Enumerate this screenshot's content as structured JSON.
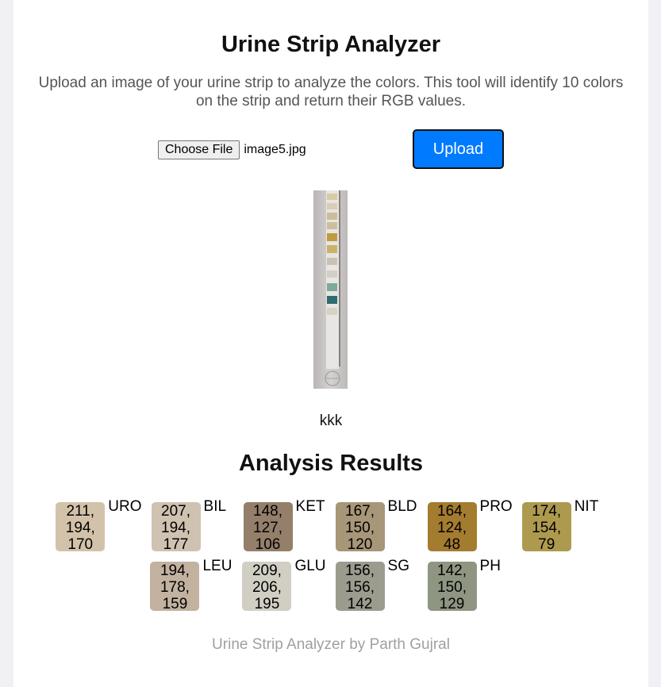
{
  "app": {
    "title": "Urine Strip Analyzer",
    "description": "Upload an image of your urine strip to analyze the colors. This tool will identify 10 colors on the strip and return their RGB values."
  },
  "upload": {
    "choose_label": "Choose File",
    "file_name": "image5.jpg",
    "upload_label": "Upload"
  },
  "preview": {
    "caption": "kkk"
  },
  "results": {
    "title": "Analysis Results",
    "items": [
      {
        "label": "URO",
        "rgb": "211, 194, 170",
        "color": "#d3c2aa"
      },
      {
        "label": "BIL",
        "rgb": "207, 194, 177",
        "color": "#cfc2b1"
      },
      {
        "label": "KET",
        "rgb": "148, 127, 106",
        "color": "#947f6a"
      },
      {
        "label": "BLD",
        "rgb": "167, 150, 120",
        "color": "#a79678"
      },
      {
        "label": "PRO",
        "rgb": "164, 124, 48",
        "color": "#a47c30"
      },
      {
        "label": "NIT",
        "rgb": "174, 154, 79",
        "color": "#ae9a4f"
      },
      {
        "label": "LEU",
        "rgb": "194, 178, 159",
        "color": "#c2b29f"
      },
      {
        "label": "GLU",
        "rgb": "209, 206, 195",
        "color": "#d1cec3"
      },
      {
        "label": "SG",
        "rgb": "156, 156, 142",
        "color": "#9c9c8e"
      },
      {
        "label": "PH",
        "rgb": "142, 150, 129",
        "color": "#8e9681"
      }
    ]
  },
  "footer": {
    "text": "Urine Strip Analyzer by Parth Gujral"
  }
}
